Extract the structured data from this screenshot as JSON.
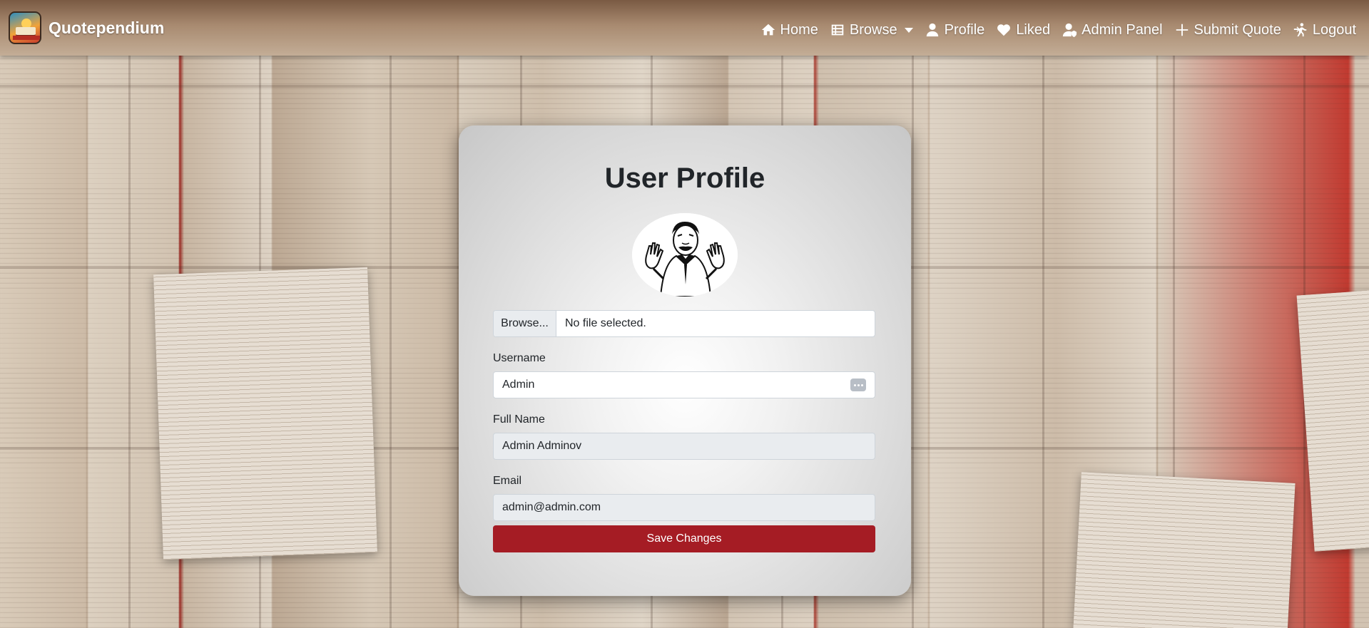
{
  "navbar": {
    "brand": "Quotependium",
    "logo_icon": "quotependium-logo",
    "links": [
      {
        "label": "Home",
        "icon": "home-icon"
      },
      {
        "label": "Browse",
        "icon": "list-icon"
      },
      {
        "label": "Profile",
        "icon": "user-icon"
      },
      {
        "label": "Liked",
        "icon": "heart-icon"
      },
      {
        "label": "Admin Panel",
        "icon": "user-shield-icon"
      },
      {
        "label": "Submit Quote",
        "icon": "plus-icon"
      },
      {
        "label": "Logout",
        "icon": "logout-icon"
      }
    ]
  },
  "profile": {
    "title": "User Profile",
    "file_button": "Browse...",
    "file_status": "No file selected.",
    "username_label": "Username",
    "username_value": "Admin",
    "fullname_label": "Full Name",
    "fullname_value": "Admin Adminov",
    "email_label": "Email",
    "email_value": "admin@admin.com",
    "save_label": "Save Changes"
  },
  "colors": {
    "accent": "#a51c24",
    "navbar": "#a88a70",
    "card": "#e6e6e6"
  }
}
